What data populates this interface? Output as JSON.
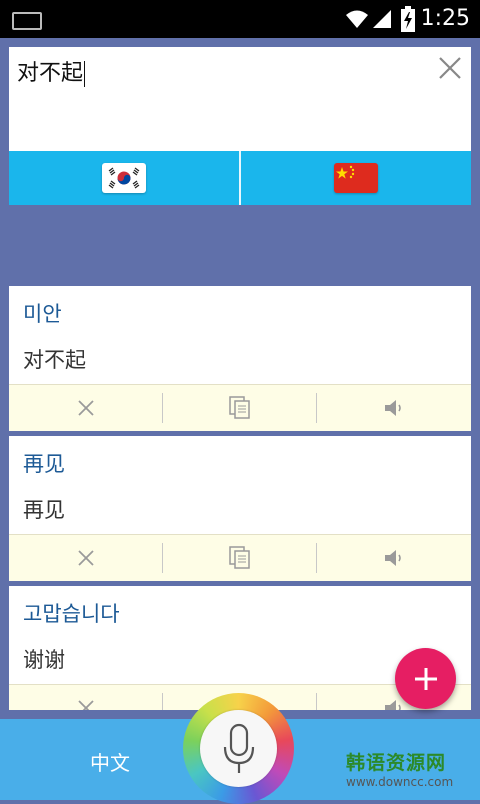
{
  "status_bar": {
    "time": "1:25"
  },
  "input": {
    "text": "对不起"
  },
  "languages": {
    "source_flag": "korea-flag",
    "target_flag": "china-flag"
  },
  "cards": [
    {
      "primary": "미안",
      "secondary": "对不起"
    },
    {
      "primary": "再见",
      "secondary": "再见"
    },
    {
      "primary": "고맙습니다",
      "secondary": "谢谢"
    }
  ],
  "bottom_bar": {
    "language_label": "中文"
  },
  "watermark": {
    "brand": "韩语资源网",
    "url": "www.downcc.com"
  },
  "colors": {
    "accent": "#1ab6ec",
    "fab": "#e61e63",
    "background": "#6070aa",
    "bottom_bar": "#49aee9",
    "primary_text": "#1d5a96"
  }
}
